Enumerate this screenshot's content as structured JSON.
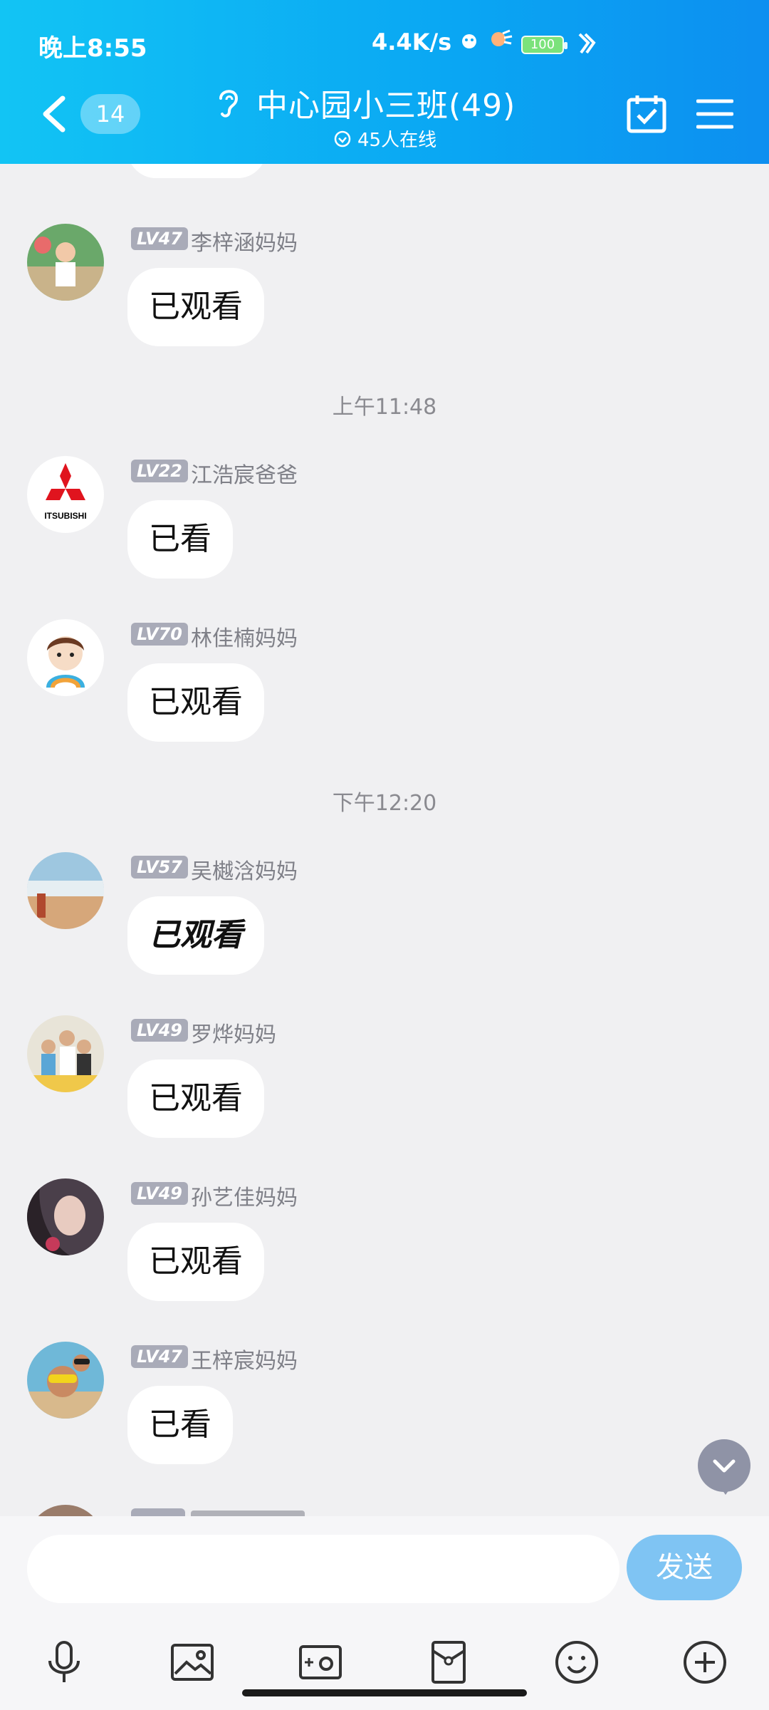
{
  "status_bar": {
    "time": "晚上8:55",
    "network_speed": "4.4K/s",
    "battery": "100"
  },
  "header": {
    "unread_count": "14",
    "title": "中心园小三班(49)",
    "online_text": "45人在线"
  },
  "time_dividers": [
    "上午11:48",
    "下午12:20"
  ],
  "messages": [
    {
      "level": "LV47",
      "sender": "李梓涵妈妈",
      "text": "已观看"
    },
    {
      "level": "LV22",
      "sender": "江浩宸爸爸",
      "text": "已看"
    },
    {
      "level": "LV70",
      "sender": "林佳楠妈妈",
      "text": "已观看"
    },
    {
      "level": "LV57",
      "sender": "吴樾浛妈妈",
      "text": "已观看"
    },
    {
      "level": "LV49",
      "sender": "罗烨妈妈",
      "text": "已观看"
    },
    {
      "level": "LV49",
      "sender": "孙艺佳妈妈",
      "text": "已观看"
    },
    {
      "level": "LV47",
      "sender": "王梓宸妈妈",
      "text": "已看"
    }
  ],
  "avatar_labels": {
    "mitsubishi": "ITSUBISHI"
  },
  "input": {
    "placeholder": "",
    "send_label": "发送"
  },
  "colors": {
    "header_start": "#12c4f4",
    "header_end": "#0d8ff0",
    "background": "#f0f0f2",
    "level_badge": "#a9abb8",
    "send_button": "#7fc4f3"
  },
  "icons": [
    "back-icon",
    "ear-icon",
    "check-circle-icon",
    "calendar-check-icon",
    "menu-icon",
    "chevron-down-icon",
    "microphone-icon",
    "image-icon",
    "camera-icon",
    "red-packet-icon",
    "emoji-icon",
    "plus-circle-icon"
  ]
}
